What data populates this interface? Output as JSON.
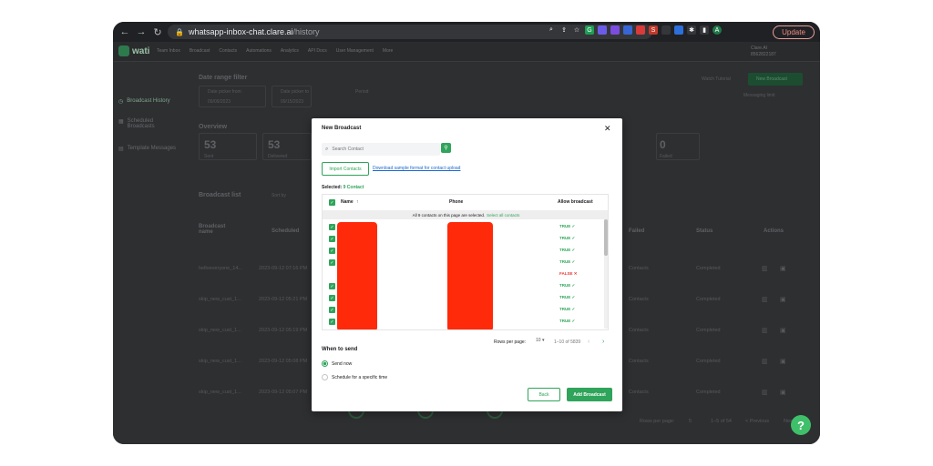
{
  "browser": {
    "url_host": "whatsapp-inbox-chat.clare.ai",
    "url_path": "/history",
    "update_label": "Update",
    "back_glyph": "←",
    "forward_glyph": "→",
    "reload_glyph": "↻"
  },
  "app": {
    "brand": "wati",
    "nav": [
      "Team Inbox",
      "Broadcast",
      "Contacts",
      "Automations",
      "Analytics",
      "API Docs",
      "User Management",
      "More"
    ],
    "user_line1": "Clare.AI",
    "user_line2": "8562822187"
  },
  "sidebar": {
    "items": [
      "Broadcast History",
      "Scheduled Broadcasts",
      "Template Messages"
    ]
  },
  "background": {
    "date_filter_title": "Date range filter",
    "date_from_label": "Date picker from",
    "date_from_value": "09/09/2023",
    "date_to_label": "Date picker to",
    "date_to_value": "09/15/2023",
    "period_label": "Period",
    "overview_title": "Overview",
    "stats": [
      {
        "value": "53",
        "label": "Sent"
      },
      {
        "value": "53",
        "label": "Delivered"
      },
      {
        "value": "0",
        "label": "Failed"
      }
    ],
    "broadcast_list_title": "Broadcast list",
    "sort_label": "Sort by",
    "watch_tutorial": "Watch Tutorial",
    "new_broadcast": "New Broadcast",
    "messaging_limit": "Messaging limit",
    "table_headers": [
      "Broadcast name",
      "Scheduled",
      "Failed",
      "Status",
      "Actions"
    ],
    "rows": [
      {
        "name": "helloeveryone_14...",
        "scheduled": "2023-09-12 07:16 PM",
        "failed": "Contacts",
        "status": "Completed"
      },
      {
        "name": "skip_new_cust_1...",
        "scheduled": "2023-09-12 05:21 PM",
        "failed": "Contacts",
        "status": "Completed"
      },
      {
        "name": "skip_new_cust_1...",
        "scheduled": "2023-09-12 05:19 PM",
        "failed": "Contacts",
        "status": "Completed"
      },
      {
        "name": "skip_new_cust_1...",
        "scheduled": "2023-09-12 05:08 PM",
        "failed": "Contacts",
        "status": "Completed"
      },
      {
        "name": "skip_new_cust_1...",
        "scheduled": "2023-09-12 05:07 PM",
        "failed": "Contacts",
        "status": "Completed"
      }
    ],
    "rows_per_page_label": "Rows per page:",
    "rows_per_page_value": "5",
    "range": "1–5 of 54",
    "previous": "< Previous",
    "next": "Next"
  },
  "modal": {
    "title": "New Broadcast",
    "close_glyph": "✕",
    "search_placeholder": "Search Contact",
    "import_label": "Import Contacts",
    "sample_link": "Download sample format for contact upload",
    "selected_label": "Selected:",
    "selected_count": "9 Contact",
    "columns": {
      "name": "Name",
      "phone": "Phone",
      "allow": "Allow broadcast"
    },
    "sort_glyph": "↑",
    "banner_text": "All 9 contacts on this page are selected.",
    "banner_link": "Select all contacts",
    "rows": [
      {
        "checked": true,
        "allow": "TRUE ✓"
      },
      {
        "checked": true,
        "allow": "TRUE ✓"
      },
      {
        "checked": true,
        "allow": "TRUE ✓"
      },
      {
        "checked": true,
        "allow": "TRUE ✓"
      },
      {
        "checked": false,
        "allow": "FALSE ✕"
      },
      {
        "checked": true,
        "allow": "TRUE ✓"
      },
      {
        "checked": true,
        "allow": "TRUE ✓"
      },
      {
        "checked": true,
        "allow": "TRUE ✓"
      },
      {
        "checked": true,
        "allow": "TRUE ✓"
      }
    ],
    "rows_per_page_label": "Rows per page:",
    "rows_per_page_value": "10 ▾",
    "range": "1–10 of 5839",
    "when_title": "When to send",
    "send_now": "Send now",
    "schedule": "Schedule for a specific time",
    "back": "Back",
    "add": "Add Broadcast"
  },
  "help_glyph": "?",
  "colors": {
    "accent": "#2fa45a",
    "danger": "#e53935",
    "redaction": "#ff2a0a"
  }
}
